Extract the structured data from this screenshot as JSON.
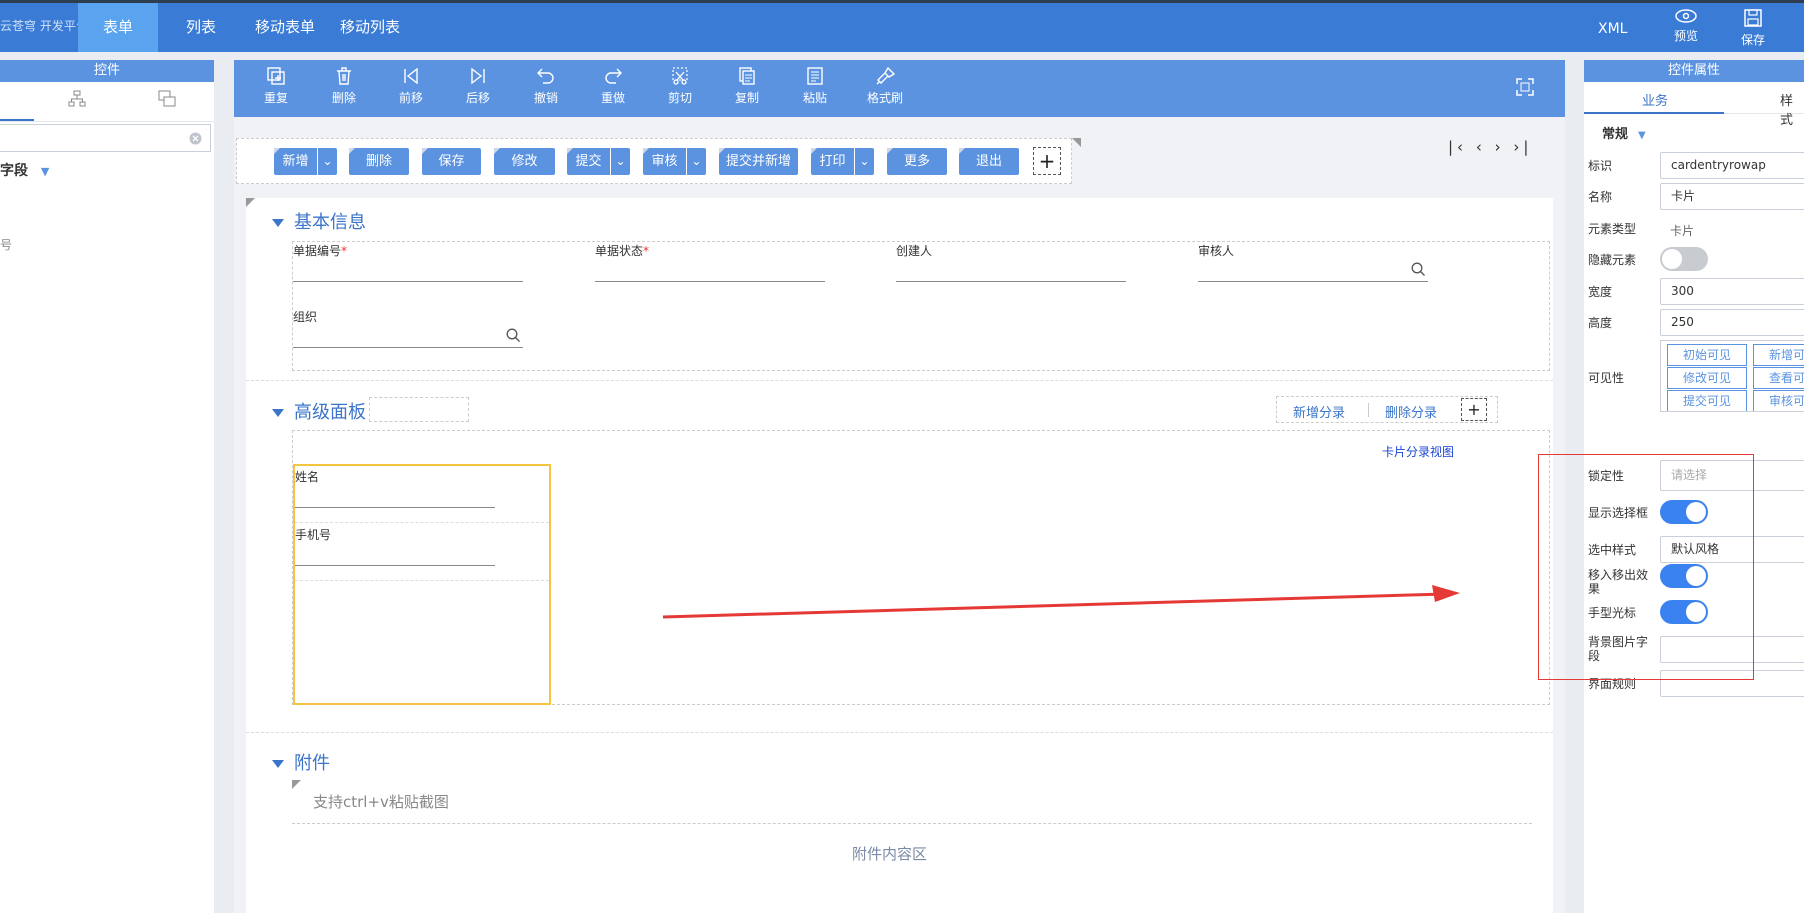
{
  "topbar": {
    "logo_text": "云苍穹 开发平台",
    "tabs": [
      {
        "label": "表单"
      },
      {
        "label": "列表"
      },
      {
        "label": "移动表单"
      },
      {
        "label": "移动列表"
      }
    ],
    "xml_label": "XML",
    "preview_label": "预览",
    "save_label": "保存"
  },
  "left_panel": {
    "title": "控件",
    "field_label": "字段",
    "side_char": "号"
  },
  "toolbar": {
    "items": [
      {
        "label": "重复",
        "icon": "duplicate-icon"
      },
      {
        "label": "删除",
        "icon": "trash-icon"
      },
      {
        "label": "前移",
        "icon": "move-first-icon"
      },
      {
        "label": "后移",
        "icon": "move-last-icon"
      },
      {
        "label": "撤销",
        "icon": "undo-icon"
      },
      {
        "label": "重做",
        "icon": "redo-icon"
      },
      {
        "label": "剪切",
        "icon": "cut-icon"
      },
      {
        "label": "复制",
        "icon": "copy-icon"
      },
      {
        "label": "粘贴",
        "icon": "paste-icon"
      },
      {
        "label": "格式刷",
        "icon": "format-brush-icon"
      }
    ]
  },
  "form_buttons": [
    {
      "label": "新增",
      "dropdown": true
    },
    {
      "label": "删除",
      "dropdown": false
    },
    {
      "label": "保存",
      "dropdown": false
    },
    {
      "label": "修改",
      "dropdown": false
    },
    {
      "label": "提交",
      "dropdown": true
    },
    {
      "label": "审核",
      "dropdown": true
    },
    {
      "label": "提交并新增",
      "dropdown": false
    },
    {
      "label": "打印",
      "dropdown": true
    },
    {
      "label": "更多",
      "dropdown": false
    },
    {
      "label": "退出",
      "dropdown": false
    }
  ],
  "pager_glyphs": "|‹ ‹ › ›|",
  "basic_info": {
    "title": "基本信息",
    "fields": [
      {
        "label": "单据编号",
        "required": true
      },
      {
        "label": "单据状态",
        "required": true
      },
      {
        "label": "创建人",
        "required": false
      },
      {
        "label": "审核人",
        "required": false
      },
      {
        "label": "组织",
        "required": false
      }
    ]
  },
  "advanced_panel": {
    "title": "高级面板",
    "add_entry": "新增分录",
    "delete_entry": "删除分录",
    "card_view_link": "卡片分录视图",
    "card_fields": [
      {
        "label": "姓名"
      },
      {
        "label": "手机号"
      }
    ]
  },
  "attachments": {
    "title": "附件",
    "paste_hint": "支持ctrl+v粘贴截图",
    "content_area": "附件内容区"
  },
  "right_panel": {
    "title": "控件属性",
    "tabs": [
      {
        "label": "业务"
      },
      {
        "label": "样式"
      }
    ],
    "group": "常规",
    "props": {
      "id_label": "标识",
      "id_value": "cardentryrowap",
      "name_label": "名称",
      "name_value": "卡片",
      "type_label": "元素类型",
      "type_value": "卡片",
      "hidden_label": "隐藏元素",
      "hidden_on": false,
      "width_label": "宽度",
      "width_value": "300",
      "height_label": "高度",
      "height_value": "250",
      "visibility_label": "可见性",
      "visibility_buttons": [
        "初始可见",
        "新增可见",
        "修改可见",
        "查看可见",
        "提交可见",
        "审核可见"
      ],
      "lock_label": "锁定性",
      "lock_placeholder": "请选择",
      "show_select_label": "显示选择框",
      "show_select_on": true,
      "select_style_label": "选中样式",
      "select_style_value": "默认风格",
      "hover_label": "移入移出效果",
      "hover_on": true,
      "hand_cursor_label": "手型光标",
      "hand_cursor_on": true,
      "bg_image_label": "背景图片字段",
      "ui_rule_label": "界面规则"
    }
  },
  "annotation": {
    "arrow_color": "#e53935",
    "highlight_color": "#e53935"
  },
  "colors": {
    "primary": "#3a7bd5",
    "accent": "#5b93e0",
    "toggle_on": "#3a82ef",
    "card_border": "#f5c542"
  }
}
